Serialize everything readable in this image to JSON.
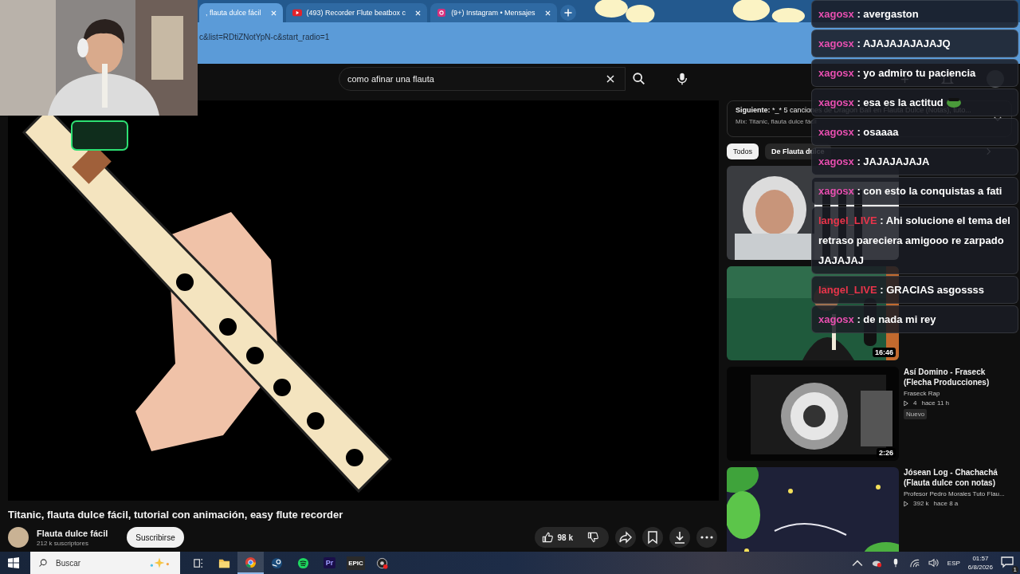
{
  "browser": {
    "tabs": [
      {
        "title": ", flauta dulce fácil",
        "selected": true
      },
      {
        "title": "(493) Recorder Flute beatbox c",
        "selected": false,
        "kind": "youtube"
      },
      {
        "title": "(9+) Instagram • Mensajes",
        "selected": false,
        "kind": "instagram"
      }
    ],
    "address": "c&list=RDtiZNotYpN-c&start_radio=1"
  },
  "header": {
    "search": {
      "value": "como afinar una flauta"
    }
  },
  "video": {
    "title": "Titanic, flauta dulce fácil, tutorial con animación, easy flute recorder",
    "channel": "Flauta dulce fácil",
    "subscribers": "212 k suscriptores",
    "subscribe": "Suscribirse",
    "likes": "98 k"
  },
  "sidebar": {
    "up_next": {
      "label": "Siguiente:",
      "title": "*_* 5 canciones de Dragon Ball en Flauta Dulce (Notas), tuto...",
      "mix": "Mix: Titanic, flauta dulce fácil"
    },
    "chips": [
      {
        "label": "Todos",
        "selected": true
      },
      {
        "label": "De Flauta dulce",
        "selected": false
      }
    ],
    "videos": [
      {
        "kind": "astronaut"
      },
      {
        "kind": "studio",
        "duration": "16:46"
      },
      {
        "kind": "speaker",
        "duration": "2:26",
        "title": "Así Domino - Fraseck (Flecha Producciones)",
        "channel": "Fraseck Rap",
        "views": "4",
        "age": "hace 11 h",
        "badge": "Nuevo"
      },
      {
        "kind": "leaves",
        "title": "Jósean Log - Chachachá (Flauta dulce con notas)",
        "channel": "Profesor Pedro Morales Tuto Flau...",
        "views": "392 k",
        "age": "hace 8 a"
      }
    ]
  },
  "chat": [
    {
      "user": "xagosx",
      "color": "#e84fb0",
      "text": ": avergaston"
    },
    {
      "user": "xagosx",
      "color": "#e84fb0",
      "text": ": AJAJAJAJAJAJQ"
    },
    {
      "user": "xagosx",
      "color": "#e84fb0",
      "text": ": yo admiro tu paciencia"
    },
    {
      "user": "xagosx",
      "color": "#e84fb0",
      "text": ": esa es la actitud",
      "emote": true
    },
    {
      "user": "xagosx",
      "color": "#e84fb0",
      "text": ": osaaaa"
    },
    {
      "user": "xagosx",
      "color": "#e84fb0",
      "text": ": JAJAJAJAJA"
    },
    {
      "user": "xagosx",
      "color": "#e84fb0",
      "text": ": con esto la conquistas a fati"
    },
    {
      "user": "langel_LIVE",
      "color": "#e8344a",
      "text": ": Ahi solucione el tema del retraso pareciera amigooo re zarpado JAJAJAJ"
    },
    {
      "user": "langel_LIVE",
      "color": "#e8344a",
      "text": ": GRACIAS asgossss"
    },
    {
      "user": "xagosx",
      "color": "#e84fb0",
      "text": ": de nada mi rey"
    }
  ],
  "taskbar": {
    "search": "Buscar",
    "apps": [
      {
        "kind": "taskview",
        "selected": false
      },
      {
        "kind": "folder",
        "selected": false
      },
      {
        "kind": "chrome",
        "selected": true
      },
      {
        "kind": "steam",
        "selected": false
      },
      {
        "kind": "spotify",
        "selected": false
      },
      {
        "kind": "premiere",
        "label": "Pr",
        "selected": false
      },
      {
        "kind": "epic",
        "label": "EPIC",
        "selected": false
      },
      {
        "kind": "obs",
        "selected": false
      }
    ],
    "language": "ESP",
    "time": "01:57",
    "date": "6/8/2026",
    "notifications": "1"
  }
}
